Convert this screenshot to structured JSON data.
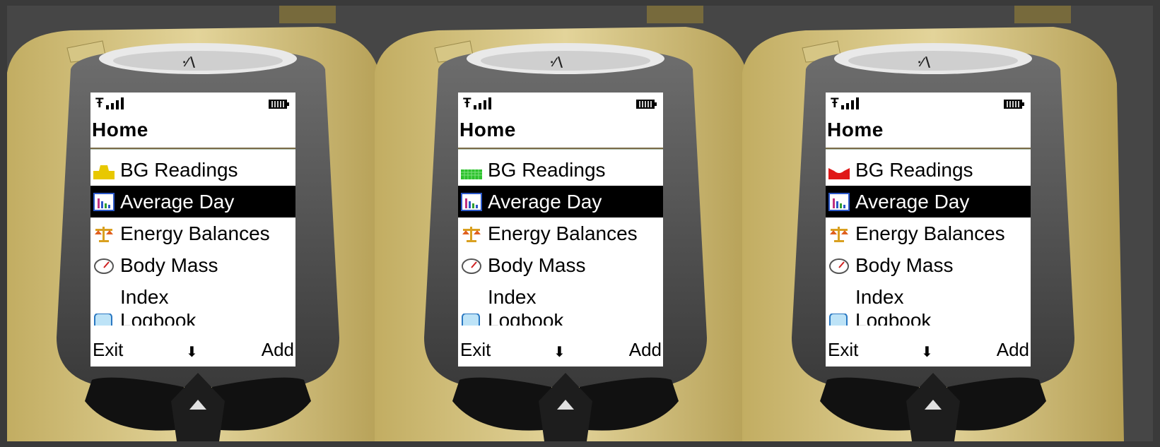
{
  "screens": [
    {
      "status": {
        "signal_icon": "antenna-icon",
        "battery_icon": "battery-icon"
      },
      "title": "Home",
      "bg_icon": "bg-status-yellow-icon",
      "bg_color": "#e8c800",
      "menu": [
        "BG Readings",
        "Average Day",
        "Energy Balances",
        "Body Mass",
        "Index",
        "Logbook"
      ],
      "selected_index": 1,
      "softkeys": {
        "left": "Exit",
        "middle": "⬇",
        "right": "Add"
      }
    },
    {
      "status": {
        "signal_icon": "antenna-icon",
        "battery_icon": "battery-icon"
      },
      "title": "Home",
      "bg_icon": "bg-status-green-icon",
      "bg_color": "#2ec22e",
      "menu": [
        "BG Readings",
        "Average Day",
        "Energy Balances",
        "Body Mass",
        "Index",
        "Logbook"
      ],
      "selected_index": 1,
      "softkeys": {
        "left": "Exit",
        "middle": "⬇",
        "right": "Add"
      }
    },
    {
      "status": {
        "signal_icon": "antenna-icon",
        "battery_icon": "battery-icon"
      },
      "title": "Home",
      "bg_icon": "bg-status-red-icon",
      "bg_color": "#e01818",
      "menu": [
        "BG Readings",
        "Average Day",
        "Energy Balances",
        "Body Mass",
        "Index",
        "Logbook"
      ],
      "selected_index": 1,
      "softkeys": {
        "left": "Exit",
        "middle": "⬇",
        "right": "Add"
      }
    }
  ]
}
